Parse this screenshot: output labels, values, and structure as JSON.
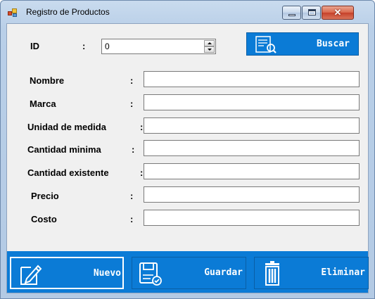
{
  "window": {
    "title": "Registro de Productos"
  },
  "titlebar_buttons": {
    "minimize": "minimize-icon",
    "maximize": "maximize-icon",
    "close": "close-icon",
    "close_glyph": "✕"
  },
  "id_field": {
    "label": "ID",
    "colon": ":",
    "value": "0"
  },
  "search_button": {
    "label": "Buscar",
    "icon": "search-document-icon"
  },
  "fields": [
    {
      "label": "Nombre",
      "colon": ":",
      "value": ""
    },
    {
      "label": "Marca",
      "colon": ":",
      "value": ""
    },
    {
      "label": "Unidad de medida",
      "colon": ":",
      "value": ""
    },
    {
      "label": "Cantidad minima",
      "colon": ":",
      "value": ""
    },
    {
      "label": "Cantidad existente",
      "colon": ":",
      "value": ""
    },
    {
      "label": "Precio",
      "colon": ":",
      "value": ""
    },
    {
      "label": "Costo",
      "colon": ":",
      "value": ""
    }
  ],
  "actions": {
    "new_label": "Nuevo",
    "save_label": "Guardar",
    "delete_label": "Eliminar"
  },
  "colors": {
    "accent": "#0b7bd6",
    "client_bg": "#f0f0f0"
  }
}
